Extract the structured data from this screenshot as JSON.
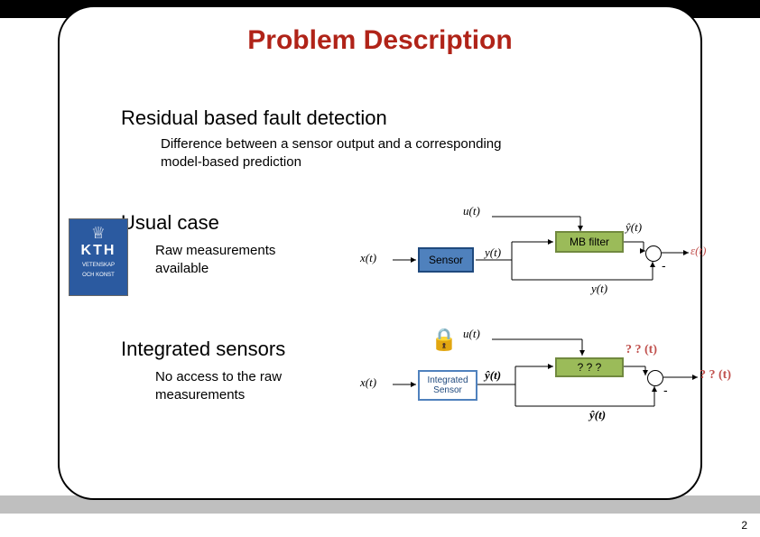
{
  "title": "Problem Description",
  "section1": {
    "heading": "Residual based fault detection",
    "desc": "Difference between a sensor output and a corresponding\nmodel-based prediction"
  },
  "section2": {
    "heading": "Usual case",
    "desc": "Raw measurements\navailable"
  },
  "section3": {
    "heading": "Integrated sensors",
    "desc": "No access to the raw\n measurements"
  },
  "kth": {
    "k": "KTH",
    "w1": "VETENSKAP",
    "w2": "OCH KONST"
  },
  "diagram1": {
    "x_t": "x(t)",
    "u_t": "u(t)",
    "y_t": "y(t)",
    "yhat_t": "ŷ(t)",
    "eps_t": "ε(t)",
    "sensor_label": "Sensor",
    "mb_label": "MB filter",
    "minus": "-"
  },
  "diagram2": {
    "x_t": "x(t)",
    "u_t": "u(t)",
    "yhat_top": "ŷ(t)",
    "yhat_bot": "ŷ(t)",
    "qq_above": "? ? (t)",
    "qq_out": "? ? (t)",
    "intsensor_line1": "Integrated",
    "intsensor_line2": "Sensor",
    "qbox_label": "? ? ?",
    "minus": "-"
  },
  "lock_icon": "🔒",
  "page_number": "2"
}
